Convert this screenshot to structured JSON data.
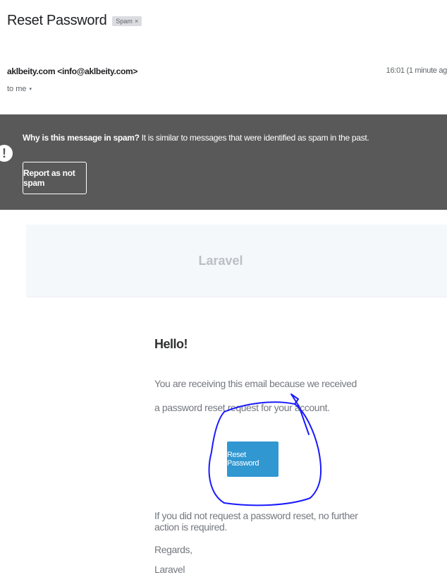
{
  "email": {
    "subject": "Reset Password",
    "label_chip": "Spam",
    "label_remove": "×",
    "sender": "aklbeity.com <info@aklbeity.com>",
    "time": "16:01 (1 minute ag",
    "recipient": "to me",
    "recipient_caret": "▾"
  },
  "spam_banner": {
    "icon": "!",
    "question": "Why is this message in spam?",
    "explanation": " It is similar to messages that were identified as spam in the past.",
    "button_label": "Report as not spam",
    "background": "#595959"
  },
  "message": {
    "header_brand": "Laravel",
    "greeting": "Hello!",
    "intro": "You are receiving this email because we received a password reset request for your account.",
    "action_label": "Reset Password",
    "action_color": "#3097d1",
    "outro": "If you did not request a password reset, no further action is required.",
    "salutation": "Regards,",
    "signature": "Laravel"
  },
  "annotation": {
    "color": "#1a1aff"
  }
}
